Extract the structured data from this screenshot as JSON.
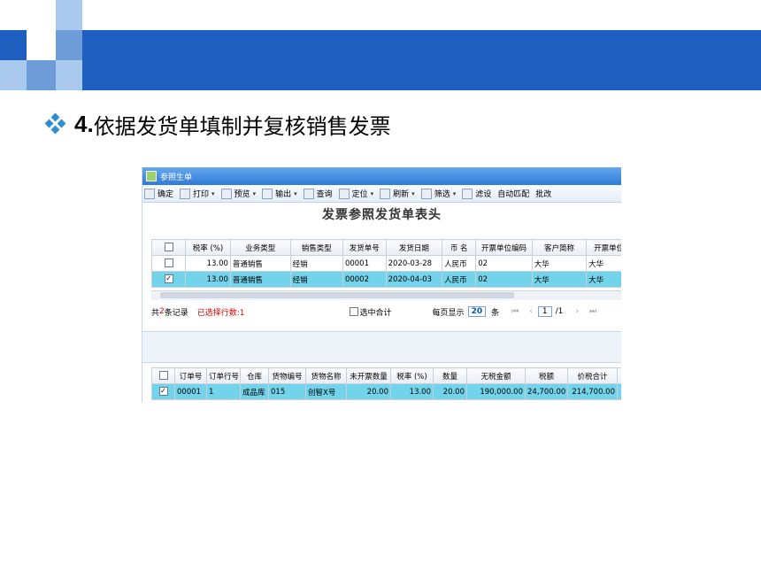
{
  "slide": {
    "heading_number": "4.",
    "heading_text": "依据发货单填制并复核销售发票"
  },
  "window": {
    "title": "参照生单",
    "toolbar": [
      {
        "label": "确定",
        "icon": "check-icon",
        "dropdown": false
      },
      {
        "label": "打印",
        "icon": "printer-icon",
        "dropdown": true
      },
      {
        "label": "预览",
        "icon": "preview-icon",
        "dropdown": true
      },
      {
        "label": "输出",
        "icon": "export-icon",
        "dropdown": true
      },
      {
        "label": "查询",
        "icon": "query-icon",
        "dropdown": false
      },
      {
        "label": "定位",
        "icon": "locate-icon",
        "dropdown": true
      },
      {
        "label": "刷新",
        "icon": "refresh-icon",
        "dropdown": true
      },
      {
        "label": "筛选",
        "icon": "filter-icon",
        "dropdown": true
      },
      {
        "label": "滤设",
        "icon": "filter-settings-icon",
        "dropdown": false
      },
      {
        "label": "自动匹配",
        "icon": "",
        "dropdown": false
      },
      {
        "label": "批改",
        "icon": "",
        "dropdown": false
      }
    ],
    "header_title": "发票参照发货单表头",
    "table1": {
      "columns": [
        "税率 (%)",
        "业务类型",
        "销售类型",
        "发货单号",
        "发货日期",
        "币 名",
        "开票单位编码",
        "客户简称",
        "开票单位名称"
      ],
      "rows": [
        {
          "checked": false,
          "cells": [
            "13.00",
            "普通销售",
            "经销",
            "00001",
            "2020-03-28",
            "人民币",
            "02",
            "大华",
            "大华"
          ]
        },
        {
          "checked": true,
          "cells": [
            "13.00",
            "普通销售",
            "经销",
            "00002",
            "2020-04-03",
            "人民币",
            "02",
            "大华",
            "大华"
          ]
        }
      ]
    },
    "pager": {
      "total_prefix": "共",
      "total_count": "2",
      "total_suffix": "条记录",
      "selected": "已选择行数:1",
      "select_total": "选中合计",
      "per_page_label": "每页显示",
      "per_page": "20",
      "per_page_unit": "条",
      "first": "⏮",
      "prev": "‹",
      "page": "1",
      "page_total": "/1",
      "next": "›",
      "last": "⏭"
    },
    "table2": {
      "columns": [
        "订单号",
        "订单行号",
        "仓库",
        "货物编号",
        "货物名称",
        "未开票数量",
        "税率 (%)",
        "数量",
        "无税金额",
        "税额",
        "价税合计"
      ],
      "rows": [
        {
          "checked": true,
          "cells": [
            "00001",
            "1",
            "成品库",
            "015",
            "创智X号",
            "20.00",
            "13.00",
            "20.00",
            "190,000.00",
            "24,700.00",
            "214,700.00"
          ]
        }
      ]
    }
  },
  "colors": {
    "banner": "#1F5FBF",
    "accent_light": "#A9C9EE",
    "accent_mid": "#6E9CD9",
    "selected_row": "#73d3ea",
    "bullet": "#2E8FD0"
  }
}
